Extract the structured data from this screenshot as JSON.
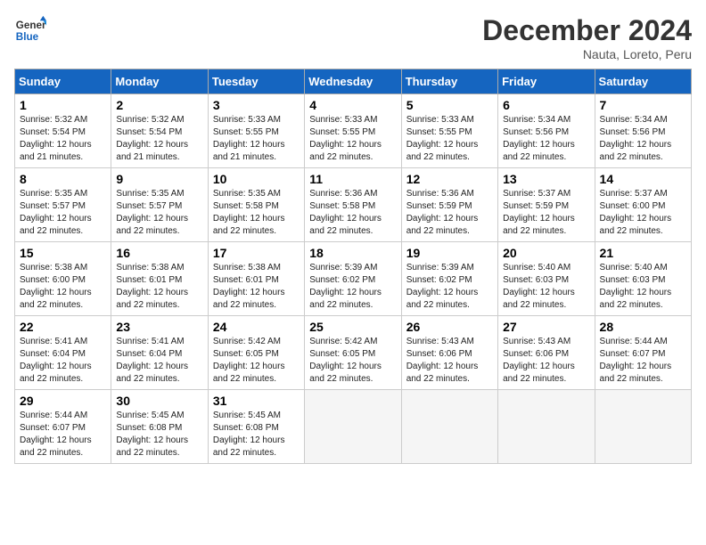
{
  "logo": {
    "line1": "General",
    "line2": "Blue"
  },
  "title": "December 2024",
  "subtitle": "Nauta, Loreto, Peru",
  "days_of_week": [
    "Sunday",
    "Monday",
    "Tuesday",
    "Wednesday",
    "Thursday",
    "Friday",
    "Saturday"
  ],
  "weeks": [
    [
      {
        "day": 1,
        "info": "Sunrise: 5:32 AM\nSunset: 5:54 PM\nDaylight: 12 hours\nand 21 minutes."
      },
      {
        "day": 2,
        "info": "Sunrise: 5:32 AM\nSunset: 5:54 PM\nDaylight: 12 hours\nand 21 minutes."
      },
      {
        "day": 3,
        "info": "Sunrise: 5:33 AM\nSunset: 5:55 PM\nDaylight: 12 hours\nand 21 minutes."
      },
      {
        "day": 4,
        "info": "Sunrise: 5:33 AM\nSunset: 5:55 PM\nDaylight: 12 hours\nand 22 minutes."
      },
      {
        "day": 5,
        "info": "Sunrise: 5:33 AM\nSunset: 5:55 PM\nDaylight: 12 hours\nand 22 minutes."
      },
      {
        "day": 6,
        "info": "Sunrise: 5:34 AM\nSunset: 5:56 PM\nDaylight: 12 hours\nand 22 minutes."
      },
      {
        "day": 7,
        "info": "Sunrise: 5:34 AM\nSunset: 5:56 PM\nDaylight: 12 hours\nand 22 minutes."
      }
    ],
    [
      {
        "day": 8,
        "info": "Sunrise: 5:35 AM\nSunset: 5:57 PM\nDaylight: 12 hours\nand 22 minutes."
      },
      {
        "day": 9,
        "info": "Sunrise: 5:35 AM\nSunset: 5:57 PM\nDaylight: 12 hours\nand 22 minutes."
      },
      {
        "day": 10,
        "info": "Sunrise: 5:35 AM\nSunset: 5:58 PM\nDaylight: 12 hours\nand 22 minutes."
      },
      {
        "day": 11,
        "info": "Sunrise: 5:36 AM\nSunset: 5:58 PM\nDaylight: 12 hours\nand 22 minutes."
      },
      {
        "day": 12,
        "info": "Sunrise: 5:36 AM\nSunset: 5:59 PM\nDaylight: 12 hours\nand 22 minutes."
      },
      {
        "day": 13,
        "info": "Sunrise: 5:37 AM\nSunset: 5:59 PM\nDaylight: 12 hours\nand 22 minutes."
      },
      {
        "day": 14,
        "info": "Sunrise: 5:37 AM\nSunset: 6:00 PM\nDaylight: 12 hours\nand 22 minutes."
      }
    ],
    [
      {
        "day": 15,
        "info": "Sunrise: 5:38 AM\nSunset: 6:00 PM\nDaylight: 12 hours\nand 22 minutes."
      },
      {
        "day": 16,
        "info": "Sunrise: 5:38 AM\nSunset: 6:01 PM\nDaylight: 12 hours\nand 22 minutes."
      },
      {
        "day": 17,
        "info": "Sunrise: 5:38 AM\nSunset: 6:01 PM\nDaylight: 12 hours\nand 22 minutes."
      },
      {
        "day": 18,
        "info": "Sunrise: 5:39 AM\nSunset: 6:02 PM\nDaylight: 12 hours\nand 22 minutes."
      },
      {
        "day": 19,
        "info": "Sunrise: 5:39 AM\nSunset: 6:02 PM\nDaylight: 12 hours\nand 22 minutes."
      },
      {
        "day": 20,
        "info": "Sunrise: 5:40 AM\nSunset: 6:03 PM\nDaylight: 12 hours\nand 22 minutes."
      },
      {
        "day": 21,
        "info": "Sunrise: 5:40 AM\nSunset: 6:03 PM\nDaylight: 12 hours\nand 22 minutes."
      }
    ],
    [
      {
        "day": 22,
        "info": "Sunrise: 5:41 AM\nSunset: 6:04 PM\nDaylight: 12 hours\nand 22 minutes."
      },
      {
        "day": 23,
        "info": "Sunrise: 5:41 AM\nSunset: 6:04 PM\nDaylight: 12 hours\nand 22 minutes."
      },
      {
        "day": 24,
        "info": "Sunrise: 5:42 AM\nSunset: 6:05 PM\nDaylight: 12 hours\nand 22 minutes."
      },
      {
        "day": 25,
        "info": "Sunrise: 5:42 AM\nSunset: 6:05 PM\nDaylight: 12 hours\nand 22 minutes."
      },
      {
        "day": 26,
        "info": "Sunrise: 5:43 AM\nSunset: 6:06 PM\nDaylight: 12 hours\nand 22 minutes."
      },
      {
        "day": 27,
        "info": "Sunrise: 5:43 AM\nSunset: 6:06 PM\nDaylight: 12 hours\nand 22 minutes."
      },
      {
        "day": 28,
        "info": "Sunrise: 5:44 AM\nSunset: 6:07 PM\nDaylight: 12 hours\nand 22 minutes."
      }
    ],
    [
      {
        "day": 29,
        "info": "Sunrise: 5:44 AM\nSunset: 6:07 PM\nDaylight: 12 hours\nand 22 minutes."
      },
      {
        "day": 30,
        "info": "Sunrise: 5:45 AM\nSunset: 6:08 PM\nDaylight: 12 hours\nand 22 minutes."
      },
      {
        "day": 31,
        "info": "Sunrise: 5:45 AM\nSunset: 6:08 PM\nDaylight: 12 hours\nand 22 minutes."
      },
      {
        "day": null,
        "info": ""
      },
      {
        "day": null,
        "info": ""
      },
      {
        "day": null,
        "info": ""
      },
      {
        "day": null,
        "info": ""
      }
    ]
  ]
}
